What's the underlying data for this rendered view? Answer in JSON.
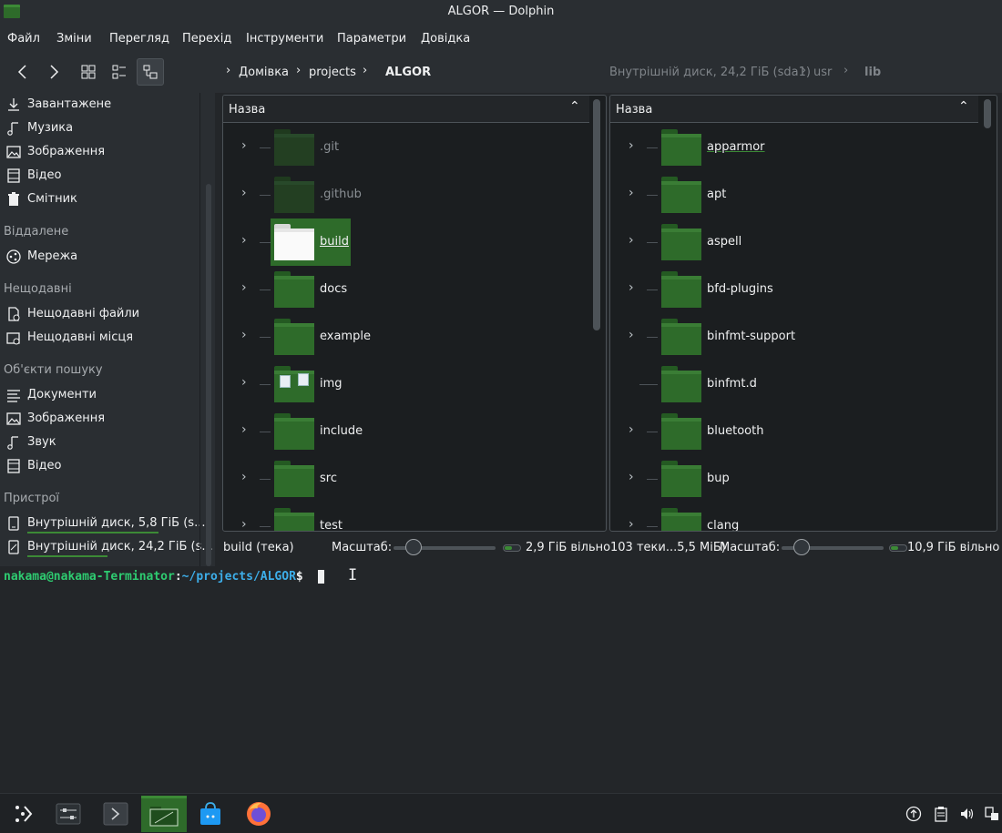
{
  "window": {
    "title": "ALGOR — Dolphin"
  },
  "menubar": {
    "items": [
      "Файл",
      "Зміни",
      "Перегляд",
      "Перехід",
      "Інструменти",
      "Параметри",
      "Довідка"
    ]
  },
  "breadcrumb_left": {
    "items": [
      "Домівка",
      "projects",
      "ALGOR"
    ]
  },
  "breadcrumb_right": {
    "items": [
      "Внутрішній диск, 24,2 ГіБ (sda1)",
      "usr",
      "lib"
    ]
  },
  "sidebar": {
    "top_items": [
      {
        "label": "Завантажене",
        "icon": "download-icon"
      },
      {
        "label": "Музика",
        "icon": "music-icon"
      },
      {
        "label": "Зображення",
        "icon": "image-icon"
      },
      {
        "label": "Відео",
        "icon": "video-icon"
      },
      {
        "label": "Смітник",
        "icon": "trash-icon"
      }
    ],
    "remote_section": "Віддалене",
    "remote_items": [
      {
        "label": "Мережа",
        "icon": "network-icon"
      }
    ],
    "recent_section": "Нещодавні",
    "recent_items": [
      {
        "label": "Нещодавні файли",
        "icon": "recent-files-icon"
      },
      {
        "label": "Нещодавні місця",
        "icon": "recent-places-icon"
      }
    ],
    "search_section": "Об'єкти пошуку",
    "search_items": [
      {
        "label": "Документи",
        "icon": "document-icon"
      },
      {
        "label": "Зображення",
        "icon": "image-icon"
      },
      {
        "label": "Звук",
        "icon": "music-icon"
      },
      {
        "label": "Відео",
        "icon": "video-icon"
      }
    ],
    "devices_section": "Пристрої",
    "device_items": [
      {
        "label": "Внутрішній диск, 5,8 ГіБ (s...",
        "icon": "drive-icon",
        "usage": 0.9
      },
      {
        "label": "Внутрішній диск, 24,2 ГіБ (s...",
        "icon": "drive-icon",
        "usage": 0.55
      }
    ]
  },
  "left_pane": {
    "header": "Назва",
    "rows": [
      {
        "name": ".git",
        "hidden": true
      },
      {
        "name": ".github",
        "hidden": true
      },
      {
        "name": "build",
        "selected": true
      },
      {
        "name": "docs"
      },
      {
        "name": "example"
      },
      {
        "name": "img",
        "image_folder": true
      },
      {
        "name": "include"
      },
      {
        "name": "src"
      },
      {
        "name": "test"
      }
    ],
    "status_text": "build (тека)",
    "zoom_label": "Масштаб:",
    "zoom_level": 0.2,
    "free_space": "2,9 ГіБ вільно"
  },
  "right_pane": {
    "header": "Назва",
    "rows": [
      {
        "name": "apparmor",
        "underlined": true
      },
      {
        "name": "apt"
      },
      {
        "name": "aspell"
      },
      {
        "name": "bfd-plugins"
      },
      {
        "name": "binfmt-support"
      },
      {
        "name": "binfmt.d",
        "no_expander": true
      },
      {
        "name": "bluetooth"
      },
      {
        "name": "bup"
      },
      {
        "name": "clang"
      }
    ],
    "status_text": "103 теки...5,5 МіБ)",
    "zoom_label": "Масштаб:",
    "zoom_level": 0.2,
    "free_space": "10,9 ГіБ вільно"
  },
  "terminal": {
    "user_host": "nakama@nakama-Terminator",
    "colon": ":",
    "path": "~/projects/ALGOR",
    "dollar": "$"
  },
  "taskbar": {
    "items": [
      "app-launcher-icon",
      "system-settings-icon",
      "konsole-icon",
      "dolphin-icon",
      "discover-icon",
      "firefox-icon"
    ],
    "tray": [
      "updates-icon",
      "clipboard-icon",
      "volume-icon",
      "network-tray-icon"
    ]
  },
  "colors": {
    "accent": "#3c8a36",
    "folder": "#2e6b2a",
    "selection": "#2e6b2a",
    "terminal_user": "#2ecc71",
    "terminal_path": "#3daee9"
  }
}
